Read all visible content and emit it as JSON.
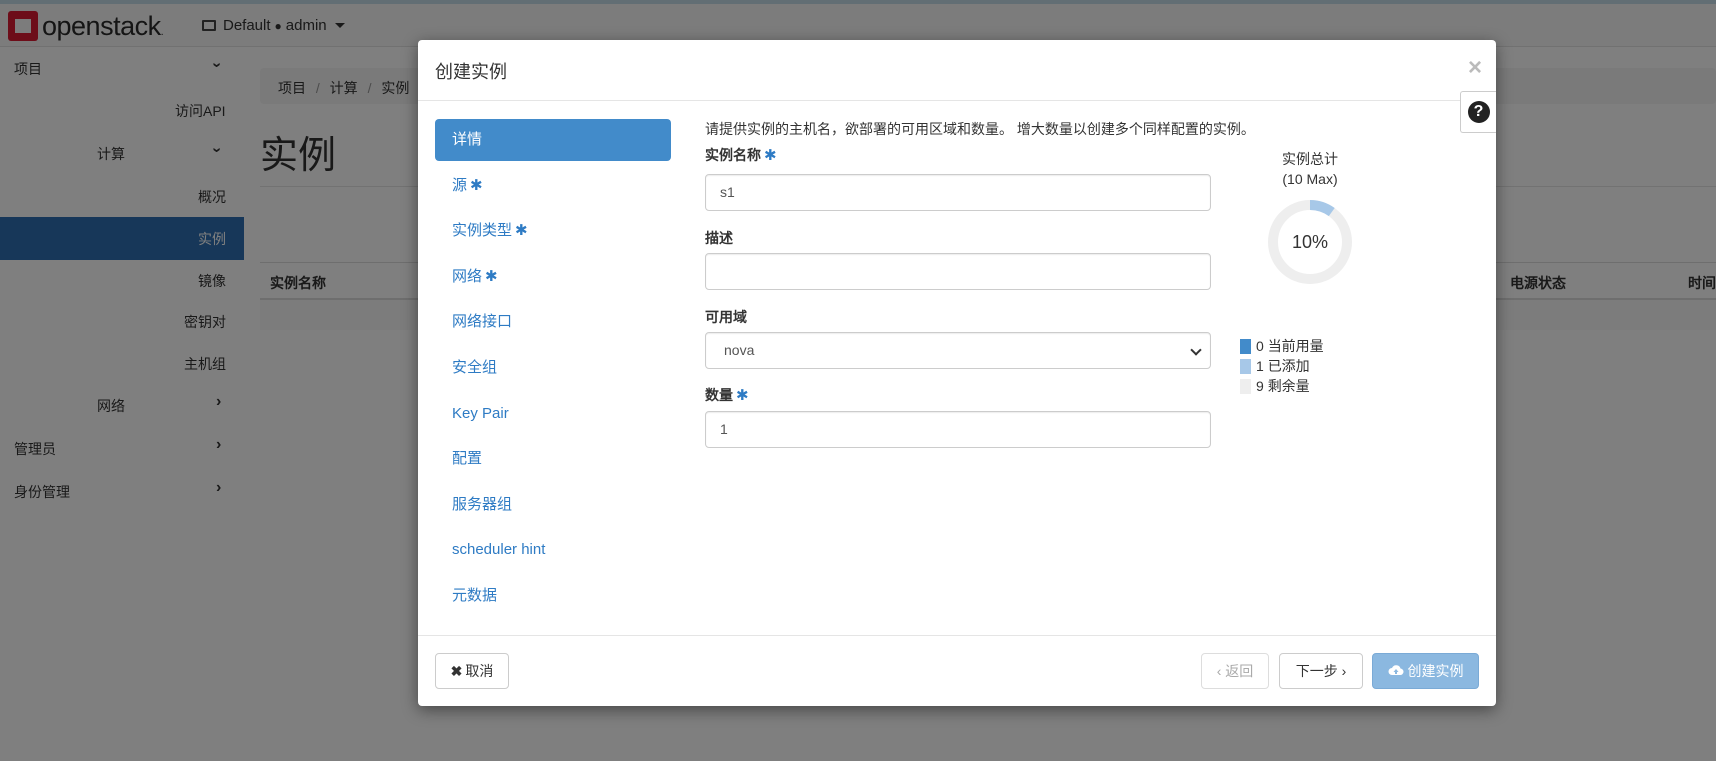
{
  "app": {
    "brand": "openstack",
    "brand_mark": ".",
    "domain": "Default",
    "user": "admin"
  },
  "sidebar": {
    "project": "项目",
    "access_api": "访问API",
    "compute": "计算",
    "overview": "概况",
    "instances": "实例",
    "images": "镜像",
    "keypairs": "密钥对",
    "server_groups": "主机组",
    "network": "网络",
    "admin": "管理员",
    "identity": "身份管理"
  },
  "page": {
    "breadcrumb": [
      "项目",
      "计算",
      "实例"
    ],
    "breadcrumb_sep": "/",
    "title": "实例",
    "col_name": "实例名称",
    "col_power": "电源状态",
    "col_time": "时间"
  },
  "modal": {
    "title": "创建实例",
    "close": "×",
    "help": "?",
    "nav": [
      {
        "label": "详情",
        "required": false
      },
      {
        "label": "源",
        "required": true
      },
      {
        "label": "实例类型",
        "required": true
      },
      {
        "label": "网络",
        "required": true
      },
      {
        "label": "网络接口",
        "required": false
      },
      {
        "label": "安全组",
        "required": false
      },
      {
        "label": "Key Pair",
        "required": false
      },
      {
        "label": "配置",
        "required": false
      },
      {
        "label": "服务器组",
        "required": false
      },
      {
        "label": "scheduler hint",
        "required": false
      },
      {
        "label": "元数据",
        "required": false
      }
    ],
    "required_mark": "✱",
    "intro": "请提供实例的主机名，欲部署的可用区域和数量。 增大数量以创建多个同样配置的实例。",
    "fields": {
      "name_label": "实例名称",
      "name_value": "s1",
      "desc_label": "描述",
      "desc_value": "",
      "az_label": "可用域",
      "az_value": "nova",
      "count_label": "数量",
      "count_value": "1"
    },
    "quota": {
      "title": "实例总计",
      "max": "(10 Max)",
      "percent": "10%",
      "used": 0,
      "added": 1,
      "remaining": 9,
      "used_label": "当前用量",
      "added_label": "已添加",
      "remaining_label": "剩余量",
      "colors": {
        "used": "#428bca",
        "added": "#a7c8e8",
        "remaining": "#eeeeee"
      }
    },
    "buttons": {
      "cancel": "取消",
      "back": "‹ 返回",
      "next": "下一步 ›",
      "create": "创建实例"
    }
  }
}
